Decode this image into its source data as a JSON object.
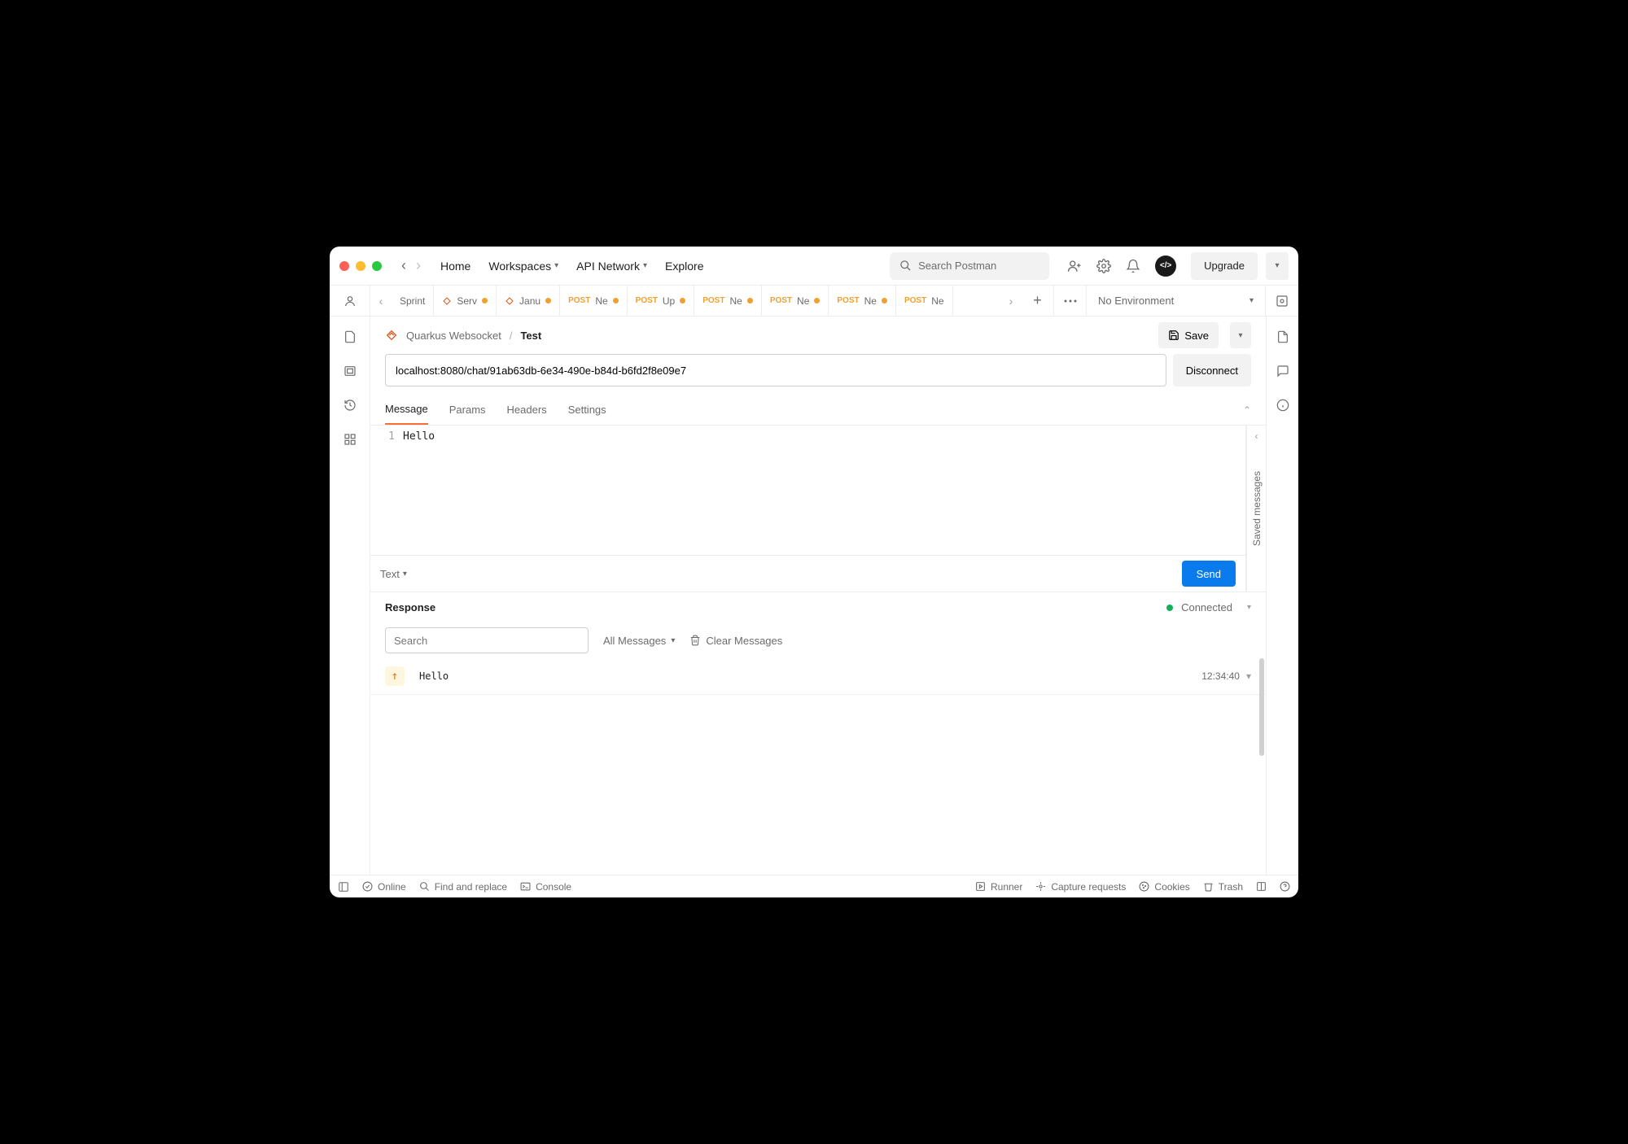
{
  "titlebar": {
    "nav": {
      "home": "Home",
      "workspaces": "Workspaces",
      "api_network": "API Network",
      "explore": "Explore"
    },
    "search_placeholder": "Search Postman",
    "upgrade": "Upgrade"
  },
  "tabstrip": {
    "tabs": [
      {
        "kind": "plain",
        "label": "Sprint"
      },
      {
        "kind": "ws",
        "label": "Serv",
        "dirty": true
      },
      {
        "kind": "ws",
        "label": "Janu",
        "dirty": true
      },
      {
        "kind": "post",
        "label": "Ne",
        "dirty": true
      },
      {
        "kind": "post",
        "label": "Up",
        "dirty": true
      },
      {
        "kind": "post",
        "label": "Ne",
        "dirty": true
      },
      {
        "kind": "post",
        "label": "Ne",
        "dirty": true
      },
      {
        "kind": "post",
        "label": "Ne",
        "dirty": true
      },
      {
        "kind": "post",
        "label": "Ne"
      }
    ],
    "environment": "No Environment"
  },
  "breadcrumb": {
    "collection": "Quarkus Websocket",
    "request": "Test",
    "save": "Save"
  },
  "request": {
    "url": "localhost:8080/chat/91ab63db-6e34-490e-b84d-b6fd2f8e09e7",
    "disconnect": "Disconnect",
    "tabs": {
      "message": "Message",
      "params": "Params",
      "headers": "Headers",
      "settings": "Settings"
    },
    "body_line_no": "1",
    "body": "Hello",
    "body_type": "Text",
    "send": "Send",
    "saved_messages": "Saved messages"
  },
  "response": {
    "title": "Response",
    "status": "Connected",
    "search_placeholder": "Search",
    "filter": "All Messages",
    "clear": "Clear Messages",
    "messages": [
      {
        "direction": "up",
        "text": "Hello",
        "time": "12:34:40"
      }
    ]
  },
  "statusbar": {
    "online": "Online",
    "find": "Find and replace",
    "console": "Console",
    "runner": "Runner",
    "capture": "Capture requests",
    "cookies": "Cookies",
    "trash": "Trash"
  },
  "post_badge": "POST"
}
